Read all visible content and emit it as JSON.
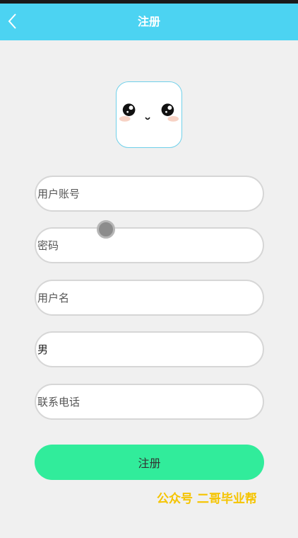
{
  "header": {
    "title": "注册",
    "back_icon": "chevron-left-icon",
    "background_color": "#4cd3f2"
  },
  "avatar": {
    "icon": "cute-face-avatar-icon"
  },
  "form": {
    "account_placeholder": "用户账号",
    "password_placeholder": "密码",
    "username_placeholder": "用户名",
    "gender_value": "男",
    "phone_placeholder": "联系电话",
    "submit_label": "注册",
    "submit_color": "#31ec9b"
  },
  "watermark": {
    "text": "公众号 二哥毕业帮",
    "color": "#f5c400"
  }
}
